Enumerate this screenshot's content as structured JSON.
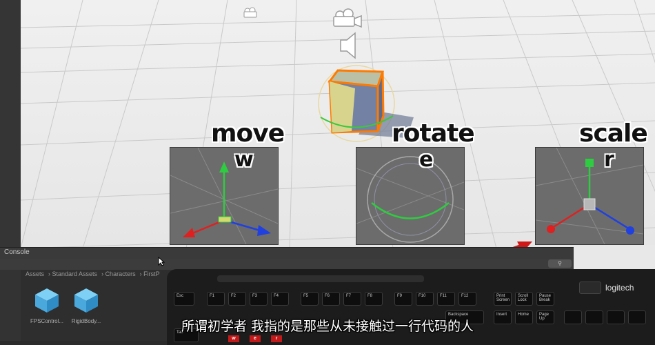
{
  "overlay_labels": {
    "move": "move",
    "move_key": "w",
    "rotate": "rotate",
    "rotate_key": "e",
    "scale": "scale",
    "scale_key": "r"
  },
  "console": {
    "tab_label": "Console",
    "breadcrumb": [
      "Assets",
      "Standard Assets",
      "Characters",
      "FirstP"
    ],
    "assets": [
      {
        "name": "FPSControl...",
        "icon": "prefab-cube-icon"
      },
      {
        "name": "RigidBody...",
        "icon": "prefab-cube-icon"
      }
    ]
  },
  "keyboard": {
    "brand": "logitech",
    "top_row": [
      "Esc",
      "F1",
      "F2",
      "F3",
      "F4",
      "F5",
      "F6",
      "F7",
      "F8",
      "F9",
      "F10",
      "F11",
      "F12",
      "Print Screen",
      "Scroll Lock",
      "Pause Break"
    ],
    "second_row": [
      "Tab",
      "Backspace",
      "Insert",
      "Home",
      "Page Up"
    ],
    "highlighted_keys": [
      "w",
      "e",
      "r"
    ]
  },
  "subtitle": "所谓初学者 我指的是那些从未接触过一行代码的人",
  "colors": {
    "highlight_red": "#c21a1a",
    "gizmo_green": "#2ecc40",
    "gizmo_red": "#e02020",
    "gizmo_blue": "#2040e0",
    "selection_orange": "#ff7a00"
  }
}
